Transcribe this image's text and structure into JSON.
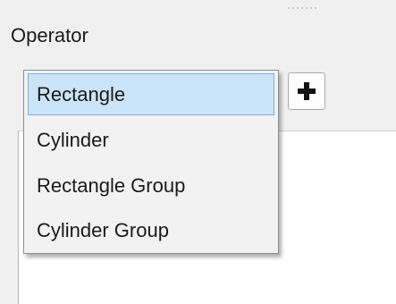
{
  "panel": {
    "operator_label": "Operator"
  },
  "add_button": {
    "icon": "plus-icon"
  },
  "dropdown": {
    "options": [
      {
        "label": "Rectangle",
        "selected": true
      },
      {
        "label": "Cylinder",
        "selected": false
      },
      {
        "label": "Rectangle Group",
        "selected": false
      },
      {
        "label": "Cylinder Group",
        "selected": false
      }
    ]
  },
  "colors": {
    "selected_bg": "#cce4f7",
    "selected_border": "#7db0e0",
    "panel_bg": "#f0f0f0"
  }
}
